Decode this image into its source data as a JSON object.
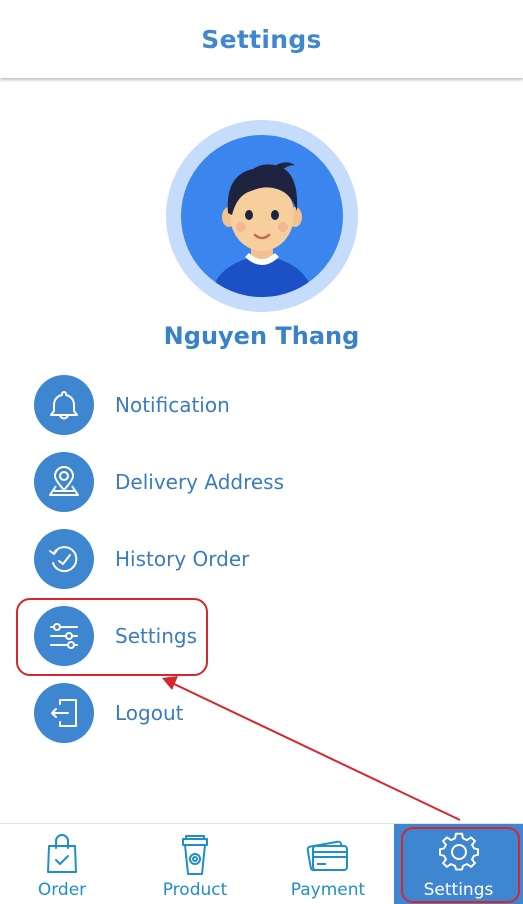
{
  "header": {
    "title": "Settings"
  },
  "profile": {
    "name": "Nguyen Thang"
  },
  "menu": {
    "items": [
      {
        "label": "Notification",
        "icon": "bell-icon"
      },
      {
        "label": "Delivery Address",
        "icon": "location-pin-icon"
      },
      {
        "label": "History Order",
        "icon": "history-icon"
      },
      {
        "label": "Settings",
        "icon": "sliders-icon"
      },
      {
        "label": "Logout",
        "icon": "logout-icon"
      }
    ]
  },
  "bottom_nav": {
    "items": [
      {
        "label": "Order",
        "icon": "shopping-bag-icon"
      },
      {
        "label": "Product",
        "icon": "coffee-cup-icon"
      },
      {
        "label": "Payment",
        "icon": "credit-card-icon"
      },
      {
        "label": "Settings",
        "icon": "gear-icon",
        "active": true
      }
    ]
  },
  "colors": {
    "primary": "#3f86d1",
    "text_blue": "#3a7cbd",
    "nav_label": "#1f8fc7",
    "annotation_red": "#d7262d"
  }
}
